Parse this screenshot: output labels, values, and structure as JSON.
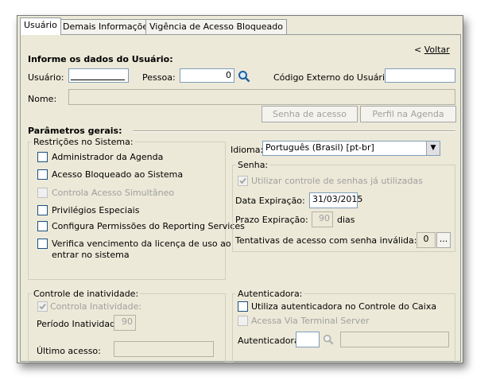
{
  "tabs": [
    "Usuário",
    "Demais Informações",
    "Vigência de Acesso Bloqueado"
  ],
  "back_link": {
    "prefix": "< ",
    "label": "Voltar"
  },
  "user_section": {
    "title": "Informe os dados do Usuário:",
    "usuario_label": "Usuário:",
    "usuario_value": "",
    "pessoa_label": "Pessoa:",
    "pessoa_value": "0",
    "codigo_label": "Código Externo do Usuário:",
    "codigo_value": "",
    "nome_label": "Nome:",
    "nome_value": ""
  },
  "buttons": {
    "senha": "Senha de acesso",
    "perfil": "Perfil na Agenda"
  },
  "params": {
    "title": "Parâmetros gerais:",
    "restricoes_title": "Restrições no Sistema:",
    "restricoes": [
      {
        "label": "Administrador da Agenda",
        "checked": false,
        "enabled": true
      },
      {
        "label": "Acesso Bloqueado ao Sistema",
        "checked": false,
        "enabled": true
      },
      {
        "label": "Controla Acesso Simultâneo",
        "checked": false,
        "enabled": false
      },
      {
        "label": "Privilégios Especiais",
        "checked": false,
        "enabled": true
      },
      {
        "label": "Configura Permissões do Reporting Services",
        "checked": false,
        "enabled": true
      },
      {
        "label_line1": "Verifica vencimento da licença de uso ao",
        "label_line2": "entrar no sistema",
        "checked": false,
        "enabled": true
      }
    ],
    "idioma_label": "Idioma:",
    "idioma_value": "Português (Brasil) [pt-br]",
    "senha_title": "Senha:",
    "senha_reuse_label": "Utilizar controle de senhas já utilizadas",
    "data_exp_label": "Data Expiração:",
    "data_exp_value": "31/03/2015",
    "prazo_label": "Prazo Expiração:",
    "prazo_value": "90",
    "prazo_unit": "dias",
    "tentativas_label": "Tentativas de acesso com senha inválida:",
    "tentativas_value": "0",
    "tentativas_button": "...",
    "inatividade_title": "Controle de inatividade:",
    "controla_inatividade_label": "Controla Inatividade:",
    "periodo_label": "Período Inatividade:",
    "periodo_value": "90",
    "ultimo_acesso_label": "Último acesso:",
    "ultimo_acesso_value": "",
    "autenticadora_title": "Autenticadora:",
    "utiliza_aut_label": "Utiliza autenticadora no Controle do Caixa",
    "acessa_via_label": "Acessa Via Terminal Server",
    "autenticadora_label": "Autenticadora:",
    "autenticadora_value": "",
    "autenticadora_desc": ""
  }
}
